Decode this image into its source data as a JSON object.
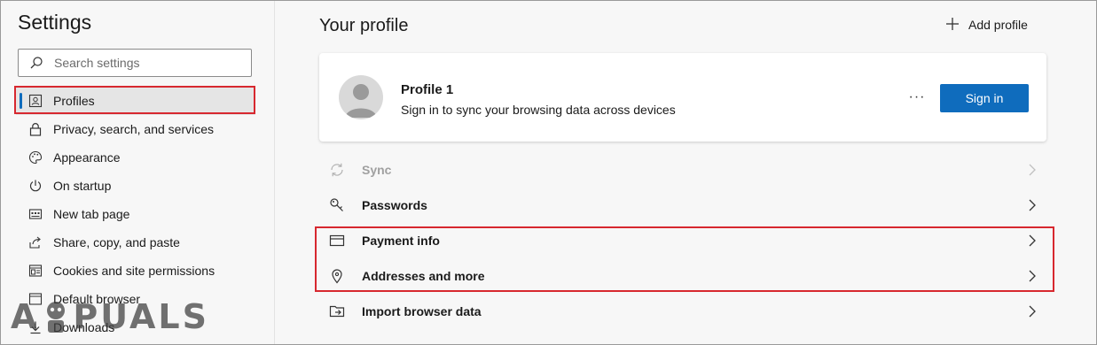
{
  "sidebar": {
    "title": "Settings",
    "search": {
      "placeholder": "Search settings",
      "value": ""
    },
    "items": [
      {
        "label": "Profiles",
        "icon": "profile-icon",
        "active": true
      },
      {
        "label": "Privacy, search, and services",
        "icon": "lock-icon"
      },
      {
        "label": "Appearance",
        "icon": "palette-icon"
      },
      {
        "label": "On startup",
        "icon": "power-icon"
      },
      {
        "label": "New tab page",
        "icon": "newtab-icon"
      },
      {
        "label": "Share, copy, and paste",
        "icon": "share-icon"
      },
      {
        "label": "Cookies and site permissions",
        "icon": "cookies-icon"
      },
      {
        "label": "Default browser",
        "icon": "browser-icon"
      },
      {
        "label": "Downloads",
        "icon": "download-icon"
      }
    ]
  },
  "main": {
    "title": "Your profile",
    "add_profile_label": "Add profile",
    "profile": {
      "name": "Profile 1",
      "subtitle": "Sign in to sync your browsing data across devices",
      "more_label": "···",
      "sign_in_label": "Sign in"
    },
    "rows": [
      {
        "label": "Sync",
        "icon": "sync-icon",
        "disabled": true
      },
      {
        "label": "Passwords",
        "icon": "key-icon"
      },
      {
        "label": "Payment info",
        "icon": "card-icon"
      },
      {
        "label": "Addresses and more",
        "icon": "location-pin-icon"
      },
      {
        "label": "Import browser data",
        "icon": "import-icon"
      }
    ]
  },
  "watermark": {
    "text": "A PUALS"
  },
  "colors": {
    "accent": "#0f6cbd",
    "highlight": "#d7282f",
    "sidebar_active": "#e5e5e5"
  }
}
